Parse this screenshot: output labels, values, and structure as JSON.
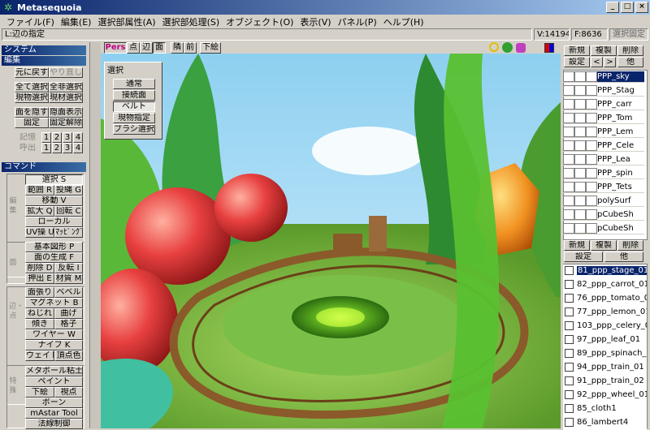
{
  "window": {
    "title": "Metasequoia",
    "app_icon": "sequoia-leaf-icon",
    "buttons": [
      "_",
      "□",
      "×"
    ]
  },
  "menu": [
    "ファイル(F)",
    "編集(E)",
    "選択部属性(A)",
    "選択部処理(S)",
    "オブジェクト(O)",
    "表示(V)",
    "パネル(P)",
    "ヘルプ(H)"
  ],
  "status": {
    "hint": "L:辺の指定",
    "vertices": "V:14194",
    "faces": "F:8636",
    "lock": "選択固定"
  },
  "left": {
    "system_header": "システム",
    "edit_header": "編集",
    "undo": "元に戻す",
    "redo": "やり直し",
    "select_all": "全て選択",
    "deselect_all": "全非選択",
    "select_object": "現物選択",
    "select_material": "現材選択",
    "hide_faces": "面を隠す",
    "show_hidden": "隠面表示",
    "lock": "固定",
    "unlock": "固定解除",
    "memory": "記憶",
    "recall": "呼出",
    "slots": [
      "1",
      "2",
      "3",
      "4"
    ],
    "command_header": "コマンド",
    "cmd_group1_label": "編集",
    "cmd_group1": [
      "選択 S",
      "範囲 R",
      "投縄 G",
      "移動 V",
      "拡大 Q",
      "回転 C",
      "ローカル",
      "UV操 U",
      "ﾏｯﾋﾟﾝｸﾞ"
    ],
    "cmd_group2_label": "面",
    "cmd_group2": [
      "基本図形 P",
      "面の生成 F",
      "削除 D",
      "反転 I",
      "押出 E",
      "材質 M"
    ],
    "cmd_group3_label": "辺・点",
    "cmd_group3": [
      "面張り",
      "ベベル",
      "マグネット B",
      "ねじれ",
      "曲げ",
      "傾き",
      "格子",
      "ワイヤー W",
      "ナイフ K",
      "ウェイト",
      "頂点色"
    ],
    "cmd_group4_label": "特殊",
    "cmd_group4": [
      "メタボール粘土",
      "ペイント",
      "下絵",
      "視点",
      "ボーン",
      "mAstar Tool",
      "法線制御"
    ]
  },
  "view_tabs": [
    "Pers",
    "点",
    "辺",
    "面",
    "隣",
    "前",
    "下絵"
  ],
  "view_icons": [
    "zoom-icon",
    "pan-icon",
    "rotate-icon",
    "layout-icon"
  ],
  "select_popup": {
    "title": "選択",
    "buttons": [
      "通常",
      "接続面",
      "ベルト",
      "現物指定",
      "ブラシ選択"
    ],
    "active": "ベルト"
  },
  "objects_panel": {
    "buttons": [
      "新規",
      "複製",
      "削除",
      "設定",
      "<",
      ">",
      "他"
    ],
    "items": [
      "PPP_sky",
      "PPP_Stag",
      "PPP_carr",
      "PPP_Tom",
      "PPP_Lem",
      "PPP_Cele",
      "PPP_Lea",
      "PPP_spin",
      "PPP_Tets",
      "polySurf",
      "pCubeSh",
      "pCubeSh"
    ]
  },
  "materials_panel": {
    "buttons": [
      "新規",
      "複製",
      "削除",
      "設定",
      "他"
    ],
    "items": [
      "81_ppp_stage_01",
      "82_ppp_carrot_01",
      "76_ppp_tomato_01",
      "77_ppp_lemon_01",
      "103_ppp_celery_0",
      "97_ppp_leaf_01",
      "89_ppp_spinach_0",
      "94_ppp_train_01",
      "91_ppp_train_02",
      "92_ppp_wheel_01",
      "85_cloth1",
      "86_lambert4"
    ]
  },
  "colors": {
    "title_active": "#0a246a",
    "face": "#d4d0c8",
    "select": "#0a246a",
    "tab_active": "#c00080"
  }
}
